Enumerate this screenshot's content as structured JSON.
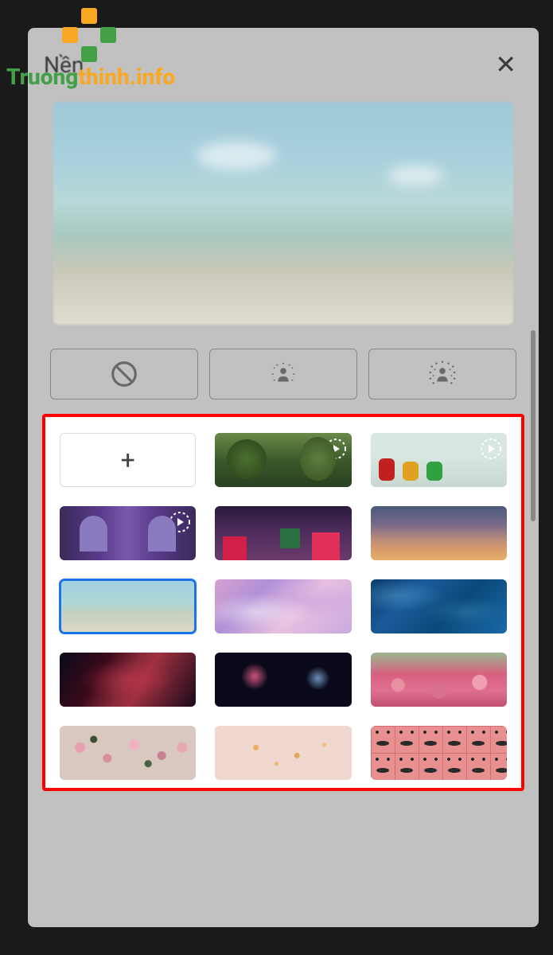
{
  "watermark": {
    "text_part1": "Truong",
    "text_part2": "thinh",
    "text_part3": ".info"
  },
  "header": {
    "title": "Nền",
    "close_label": "✕"
  },
  "effects": {
    "none_label": "no-effect",
    "blur_light_label": "slight-blur",
    "blur_strong_label": "strong-blur"
  },
  "backgrounds": {
    "add_label": "+",
    "tiles": [
      {
        "id": "add",
        "name": "add-custom",
        "animated": false,
        "selected": false
      },
      {
        "id": "forest",
        "name": "forest-animated",
        "animated": true,
        "selected": false
      },
      {
        "id": "classroom",
        "name": "classroom-animated",
        "animated": true,
        "selected": false
      },
      {
        "id": "cave",
        "name": "cave-animated",
        "animated": true,
        "selected": false
      },
      {
        "id": "night",
        "name": "festival-night",
        "animated": false,
        "selected": false
      },
      {
        "id": "sunset",
        "name": "sunset-gradient",
        "animated": false,
        "selected": false
      },
      {
        "id": "beach",
        "name": "beach",
        "animated": false,
        "selected": true
      },
      {
        "id": "clouds",
        "name": "pink-clouds",
        "animated": false,
        "selected": false
      },
      {
        "id": "ocean",
        "name": "ocean-waves",
        "animated": false,
        "selected": false
      },
      {
        "id": "nebula",
        "name": "nebula-red",
        "animated": false,
        "selected": false
      },
      {
        "id": "fireworks",
        "name": "fireworks",
        "animated": false,
        "selected": false
      },
      {
        "id": "flowers",
        "name": "pink-flowers",
        "animated": false,
        "selected": false
      },
      {
        "id": "blossom",
        "name": "cherry-blossom",
        "animated": false,
        "selected": false
      },
      {
        "id": "sparkle",
        "name": "gold-sparkle",
        "animated": false,
        "selected": false
      },
      {
        "id": "pattern",
        "name": "pink-face-pattern",
        "animated": false,
        "selected": false
      }
    ]
  }
}
